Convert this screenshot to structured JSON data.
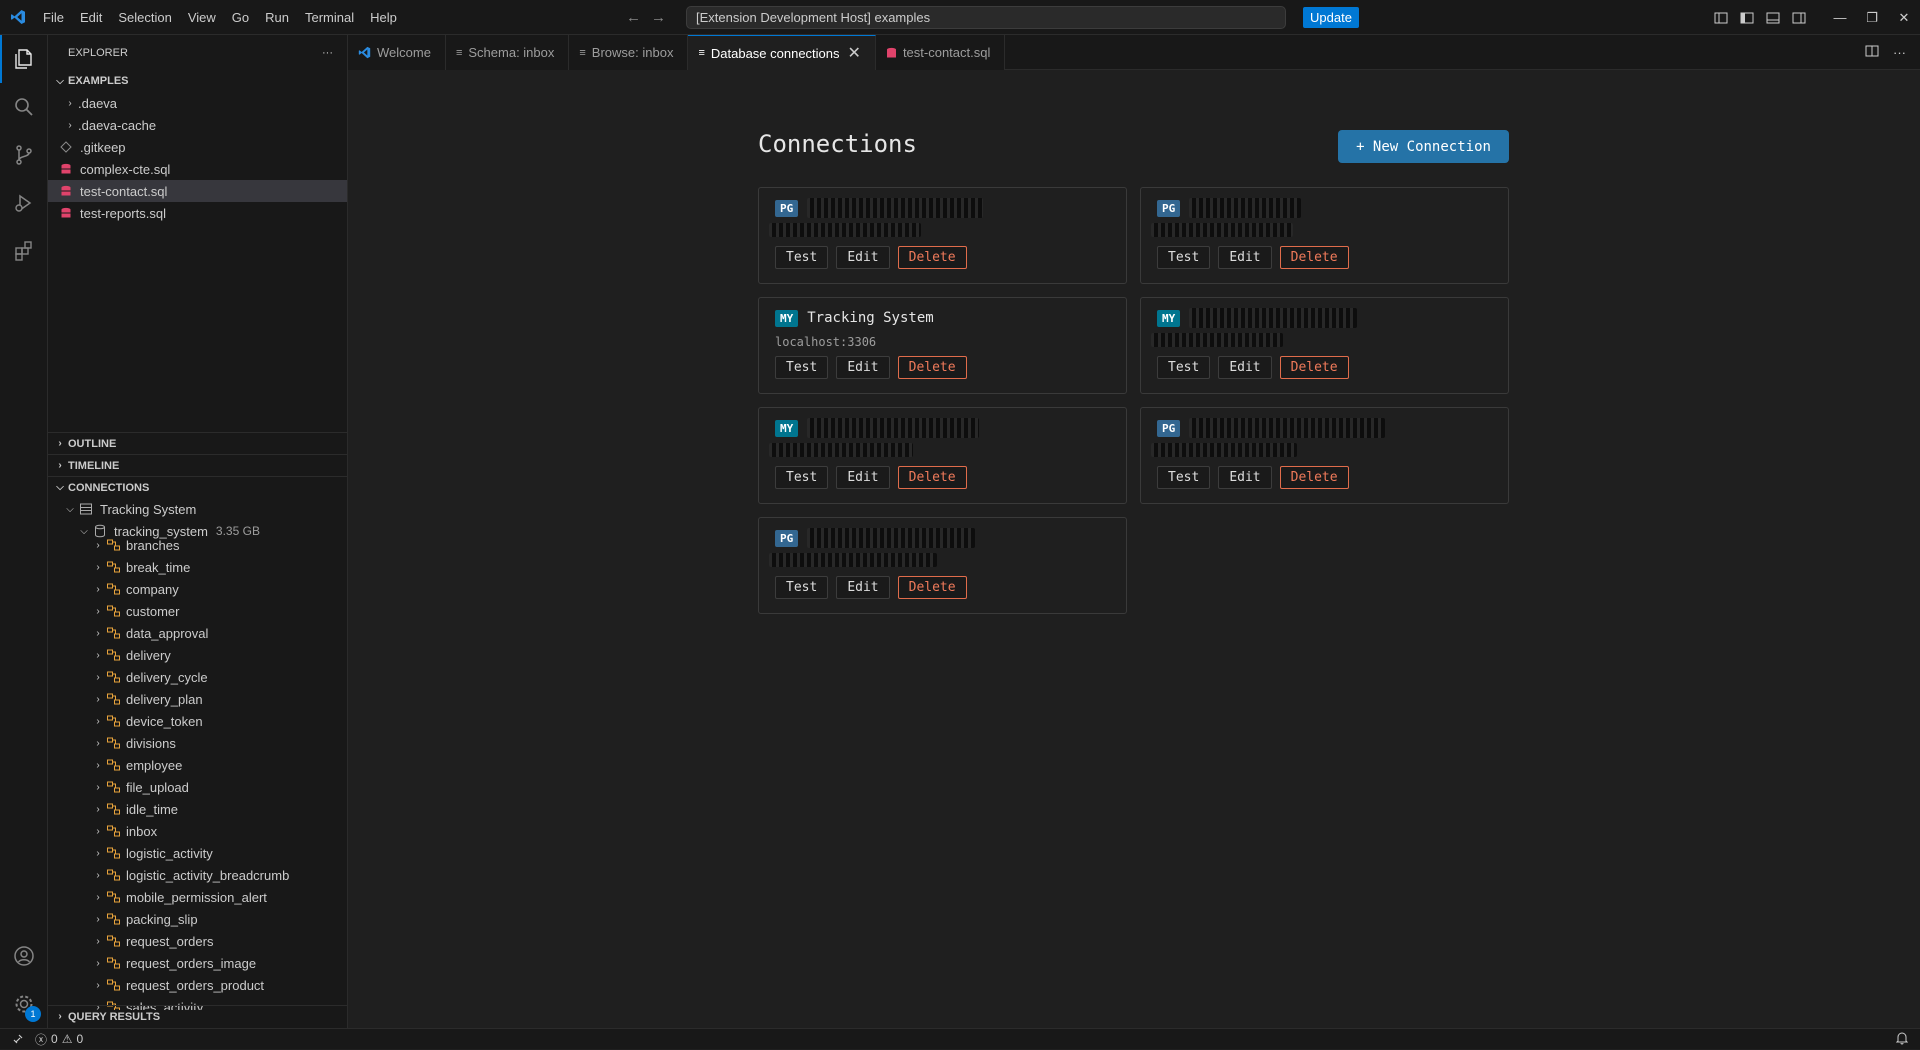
{
  "menu": [
    "File",
    "Edit",
    "Selection",
    "View",
    "Go",
    "Run",
    "Terminal",
    "Help"
  ],
  "command_center": "[Extension Development Host] examples",
  "update_label": "Update",
  "explorer": {
    "title": "EXPLORER",
    "workspace": "EXAMPLES",
    "files": [
      {
        "name": ".daeva",
        "kind": "folder"
      },
      {
        "name": ".daeva-cache",
        "kind": "folder"
      },
      {
        "name": ".gitkeep",
        "kind": "file"
      },
      {
        "name": "complex-cte.sql",
        "kind": "sql"
      },
      {
        "name": "test-contact.sql",
        "kind": "sql",
        "selected": true
      },
      {
        "name": "test-reports.sql",
        "kind": "sql"
      }
    ],
    "outline": "OUTLINE",
    "timeline": "TIMELINE",
    "connections": "CONNECTIONS",
    "connection_name": "Tracking System",
    "db_name": "tracking_system",
    "db_size": "3.35 GB",
    "tables": [
      "branches",
      "break_time",
      "company",
      "customer",
      "data_approval",
      "delivery",
      "delivery_cycle",
      "delivery_plan",
      "device_token",
      "divisions",
      "employee",
      "file_upload",
      "idle_time",
      "inbox",
      "logistic_activity",
      "logistic_activity_breadcrumb",
      "mobile_permission_alert",
      "packing_slip",
      "request_orders",
      "request_orders_image",
      "request_orders_product",
      "sales_activity"
    ],
    "query_results": "QUERY RESULTS"
  },
  "tabs": [
    {
      "label": "Welcome",
      "icon": "vscode-icon"
    },
    {
      "label": "Schema: inbox",
      "icon": "preview-icon"
    },
    {
      "label": "Browse: inbox",
      "icon": "preview-icon"
    },
    {
      "label": "Database connections",
      "icon": "preview-icon",
      "active": true
    },
    {
      "label": "test-contact.sql",
      "icon": "database-icon"
    }
  ],
  "page": {
    "title": "Connections",
    "new_button": "+ New Connection",
    "buttons": {
      "test": "Test",
      "edit": "Edit",
      "delete": "Delete"
    },
    "connections": [
      {
        "tag": "PG",
        "name": "",
        "host": "",
        "redacted": true
      },
      {
        "tag": "PG",
        "name": "",
        "host": "",
        "redacted": true
      },
      {
        "tag": "MY",
        "name": "Tracking System",
        "host": "localhost:3306",
        "redacted": false
      },
      {
        "tag": "MY",
        "name": "",
        "host": "",
        "redacted": true
      },
      {
        "tag": "MY",
        "name": "",
        "host": "",
        "redacted": true
      },
      {
        "tag": "PG",
        "name": "",
        "host": "",
        "redacted": true
      },
      {
        "tag": "PG",
        "name": "",
        "host": "",
        "redacted": true
      }
    ]
  },
  "status": {
    "errors": "0",
    "warnings": "0",
    "accounts_badge": "1"
  }
}
